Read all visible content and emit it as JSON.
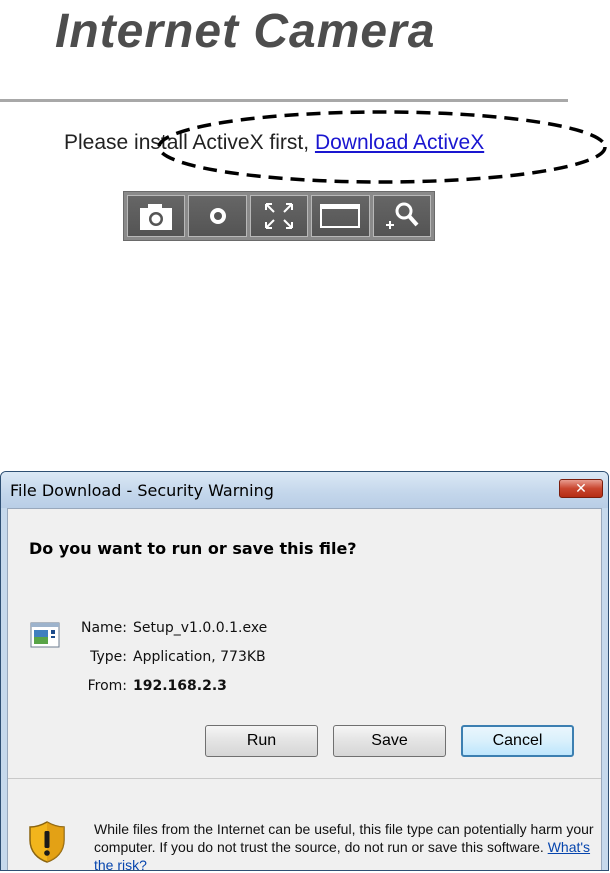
{
  "header": {
    "title": "Internet Camera",
    "install_text": "Please install ActiveX first, ",
    "download_link": "Download ActiveX"
  },
  "toolbar": {
    "buttons": [
      {
        "icon": "camera-icon"
      },
      {
        "icon": "record-icon"
      },
      {
        "icon": "fullscreen-icon"
      },
      {
        "icon": "window-icon"
      },
      {
        "icon": "zoom-icon"
      }
    ]
  },
  "dialog": {
    "title": "File Download - Security Warning",
    "close_label": "✕",
    "question": "Do you want to run or save this file?",
    "name_label": "Name:",
    "name_value": "Setup_v1.0.0.1.exe",
    "type_label": "Type:",
    "type_value": "Application, 773KB",
    "from_label": "From:",
    "from_value": "192.168.2.3",
    "run_label": "Run",
    "save_label": "Save",
    "cancel_label": "Cancel",
    "warning_text": "While files from the Internet can be useful, this file type can potentially harm your computer. If you do not trust the source, do not run or save this software. ",
    "risk_link": "What's the risk?"
  },
  "colors": {
    "link": "#1a16d0",
    "title_gray": "#4d4d4d",
    "dialog_frame": "#c6d9ec"
  }
}
